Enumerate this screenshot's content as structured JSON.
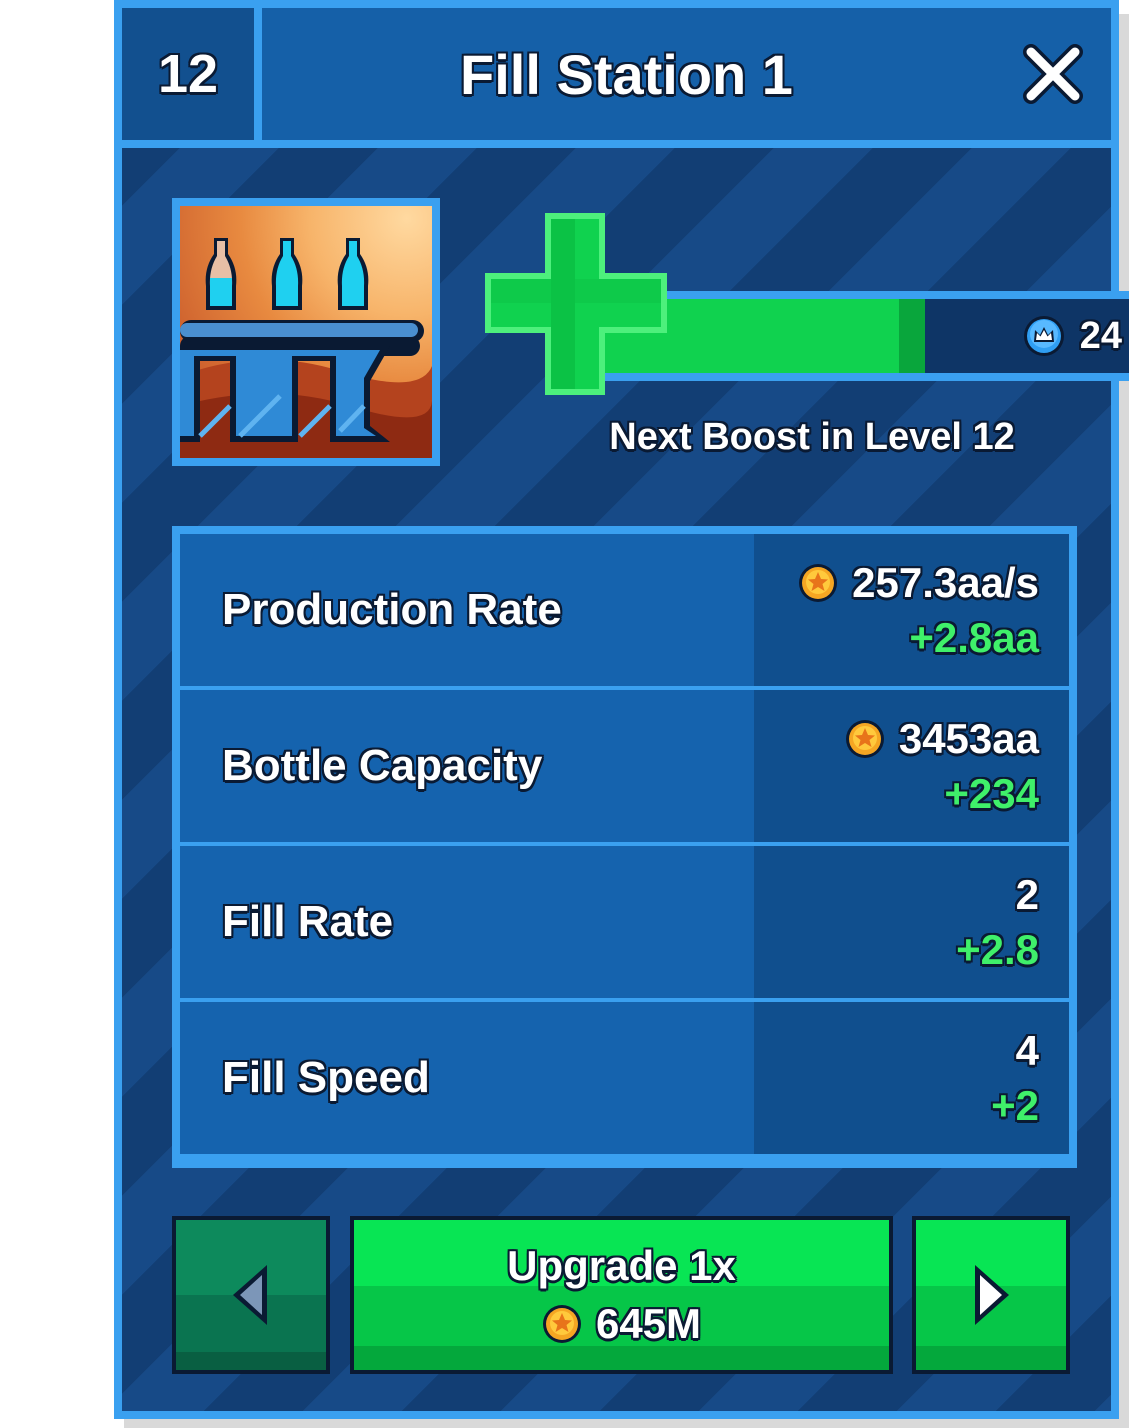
{
  "header": {
    "level": "12",
    "title": "Fill Station 1",
    "close_icon": "close-icon"
  },
  "boost": {
    "progress_fraction": 0.55,
    "count": "24",
    "next_text": "Next Boost in Level 12",
    "icon": "crown-gem-icon"
  },
  "stats": [
    {
      "label": "Production Rate",
      "value": "257.3aa/s",
      "delta": "+2.8aa",
      "has_coin": true
    },
    {
      "label": "Bottle Capacity",
      "value": "3453aa",
      "delta": "+234",
      "has_coin": true
    },
    {
      "label": "Fill Rate",
      "value": "2",
      "delta": "+2.8",
      "has_coin": false
    },
    {
      "label": "Fill Speed",
      "value": "4",
      "delta": "+2",
      "has_coin": false
    }
  ],
  "upgrade": {
    "label": "Upgrade 1x",
    "cost": "645M"
  },
  "colors": {
    "panel_border": "#3aa0f0",
    "panel_bg": "#14427c",
    "accent_green": "#10d24f",
    "delta_green": "#3ff06a"
  }
}
